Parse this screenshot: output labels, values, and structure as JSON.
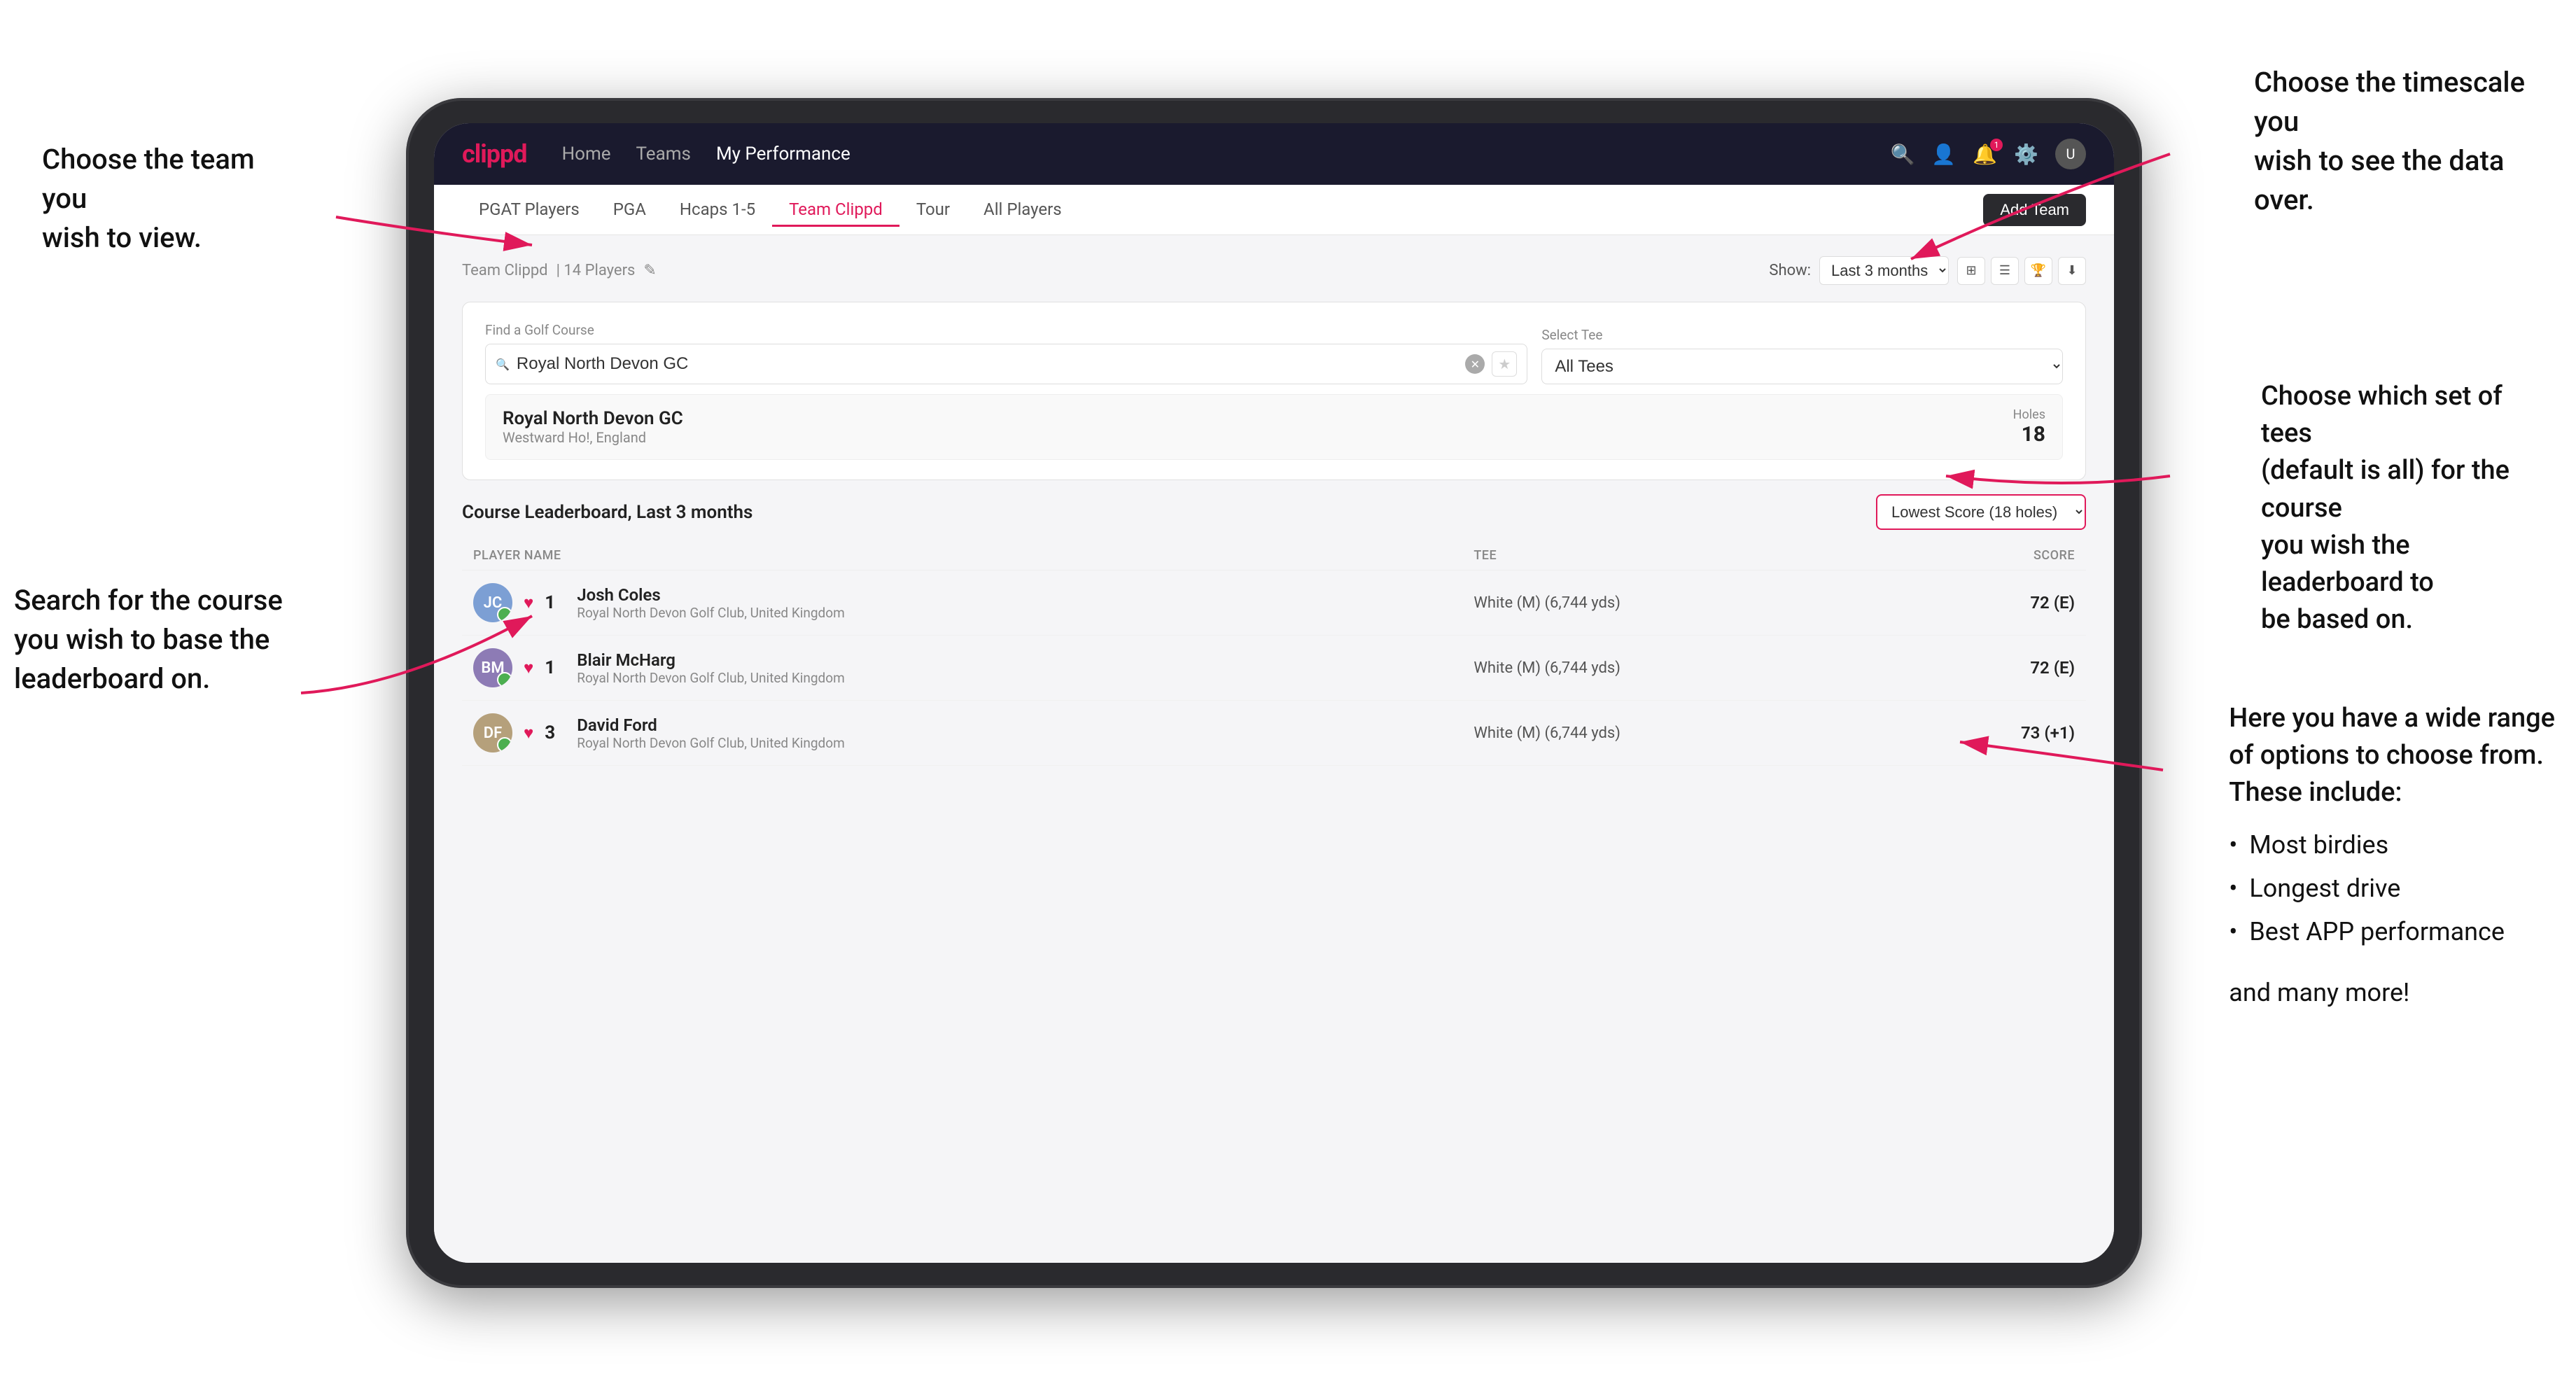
{
  "annotations": {
    "top_left_title": "Choose the team you\nwish to view.",
    "bottom_left_title": "Search for the course\nyou wish to base the\nleaderboard on.",
    "top_right_title": "Choose the timescale you\nwish to see the data over.",
    "middle_right_title": "Choose which set of tees\n(default is all) for the course\nyou wish the leaderboard to\nbe based on.",
    "bottom_right_title": "Here you have a wide range\nof options to choose from.\nThese include:",
    "bullet_items": [
      "Most birdies",
      "Longest drive",
      "Best APP performance"
    ],
    "and_more": "and many more!"
  },
  "nav": {
    "logo": "clippd",
    "links": [
      "Home",
      "Teams",
      "My Performance"
    ],
    "active_link": "My Performance"
  },
  "sub_tabs": {
    "tabs": [
      "PGAT Players",
      "PGA",
      "Hcaps 1-5",
      "Team Clippd",
      "Tour",
      "All Players"
    ],
    "active_tab": "Team Clippd",
    "add_team_label": "Add Team"
  },
  "team_header": {
    "title": "Team Clippd",
    "player_count": "14 Players",
    "show_label": "Show:",
    "time_filter": "Last 3 months"
  },
  "search_section": {
    "find_label": "Find a Golf Course",
    "course_value": "Royal North Devon GC",
    "select_tee_label": "Select Tee",
    "tee_value": "All Tees"
  },
  "course_result": {
    "name": "Royal North Devon GC",
    "location": "Westward Ho!, England",
    "holes_label": "Holes",
    "holes_value": "18"
  },
  "leaderboard": {
    "title": "Course Leaderboard,",
    "period": "Last 3 months",
    "score_type": "Lowest Score (18 holes)",
    "columns": {
      "player": "PLAYER NAME",
      "tee": "TEE",
      "score": "SCORE"
    },
    "players": [
      {
        "rank": "1",
        "name": "Josh Coles",
        "club": "Royal North Devon Golf Club, United Kingdom",
        "tee": "White (M) (6,744 yds)",
        "score": "72 (E)"
      },
      {
        "rank": "1",
        "name": "Blair McHarg",
        "club": "Royal North Devon Golf Club, United Kingdom",
        "tee": "White (M) (6,744 yds)",
        "score": "72 (E)"
      },
      {
        "rank": "3",
        "name": "David Ford",
        "club": "Royal North Devon Golf Club, United Kingdom",
        "tee": "White (M) (6,744 yds)",
        "score": "73 (+1)"
      }
    ]
  },
  "colors": {
    "brand_red": "#e0195a",
    "nav_dark": "#1a1a2e",
    "active_tab": "#e0195a"
  }
}
